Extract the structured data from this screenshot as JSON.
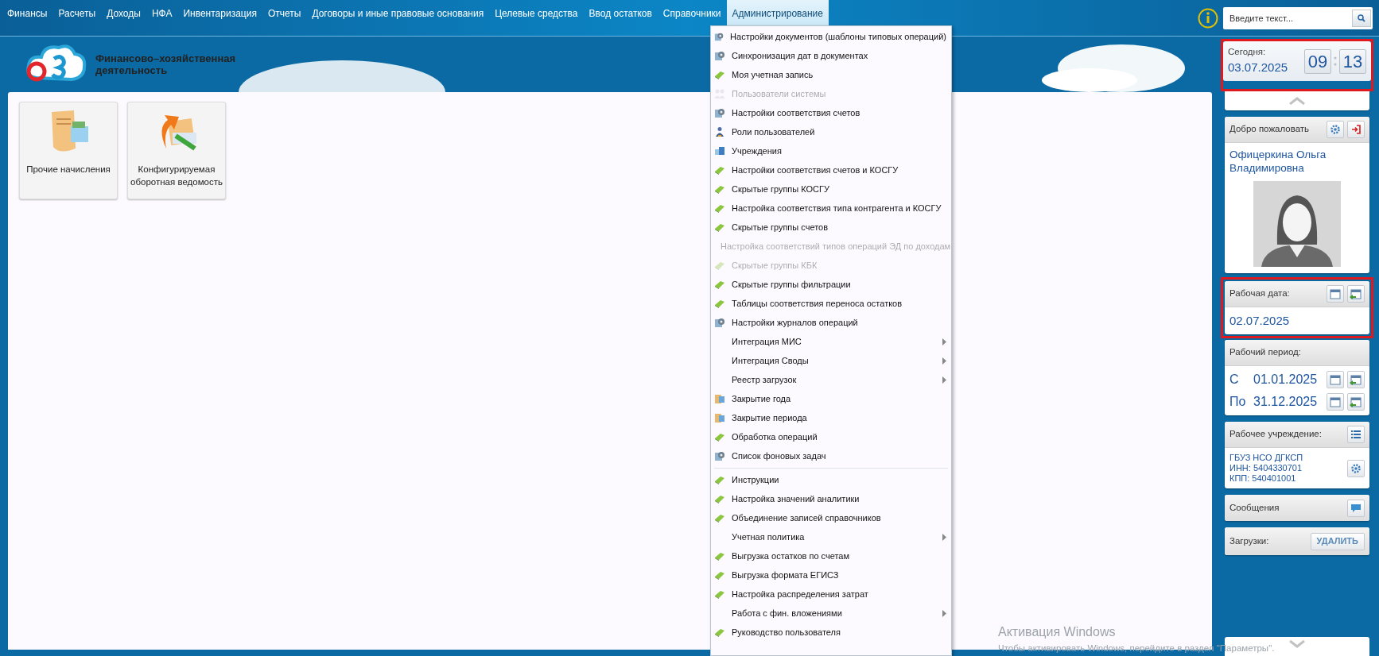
{
  "nav": [
    {
      "label": "Финансы",
      "selected": false
    },
    {
      "label": "Расчеты",
      "selected": false
    },
    {
      "label": "Доходы",
      "selected": false
    },
    {
      "label": "НФА",
      "selected": false
    },
    {
      "label": "Инвентаризация",
      "selected": false
    },
    {
      "label": "Отчеты",
      "selected": false
    },
    {
      "label": "Договоры и иные правовые основания",
      "selected": false
    },
    {
      "label": "Целевые средства",
      "selected": false
    },
    {
      "label": "Ввод остатков",
      "selected": false
    },
    {
      "label": "Справочники",
      "selected": false
    },
    {
      "label": "Администрирование",
      "selected": true
    }
  ],
  "search": {
    "placeholder": "Введите текст..."
  },
  "app_title": "Финансово–хозяйственная деятельность",
  "tiles": [
    {
      "label": "Прочие начисления",
      "kind": "document"
    },
    {
      "label": "Конфигурируемая оборотная ведомость",
      "kind": "ledger"
    }
  ],
  "menu": [
    {
      "kind": "gear",
      "label": "Настройки документов (шаблоны типовых операций)",
      "disabled": false,
      "submenu": false
    },
    {
      "kind": "gear",
      "label": "Синхронизация дат в документах",
      "disabled": false,
      "submenu": false
    },
    {
      "kind": "book",
      "label": "Моя учетная запись",
      "disabled": false,
      "submenu": false
    },
    {
      "kind": "users",
      "label": "Пользователи системы",
      "disabled": true,
      "submenu": false
    },
    {
      "kind": "gear",
      "label": "Настройки соответствия счетов",
      "disabled": false,
      "submenu": false
    },
    {
      "kind": "person",
      "label": "Роли пользователей",
      "disabled": false,
      "submenu": false
    },
    {
      "kind": "building",
      "label": "Учреждения",
      "disabled": false,
      "submenu": false
    },
    {
      "kind": "book",
      "label": "Настройки соответствия счетов и КОСГУ",
      "disabled": false,
      "submenu": false
    },
    {
      "kind": "book",
      "label": "Скрытые группы КОСГУ",
      "disabled": false,
      "submenu": false
    },
    {
      "kind": "book",
      "label": "Настройка соответствия типа контрагента и КОСГУ",
      "disabled": false,
      "submenu": false
    },
    {
      "kind": "book",
      "label": "Скрытые группы счетов",
      "disabled": false,
      "submenu": false
    },
    {
      "kind": "book",
      "label": "Настройка соответствий типов операций ЭД по доходам",
      "disabled": true,
      "submenu": false
    },
    {
      "kind": "book",
      "label": "Скрытые группы КБК",
      "disabled": true,
      "submenu": false
    },
    {
      "kind": "book",
      "label": "Скрытые группы фильтрации",
      "disabled": false,
      "submenu": false
    },
    {
      "kind": "book",
      "label": "Таблицы соответствия переноса остатков",
      "disabled": false,
      "submenu": false
    },
    {
      "kind": "gear",
      "label": "Настройки журналов операций",
      "disabled": false,
      "submenu": false
    },
    {
      "kind": "plain",
      "label": "Интеграция МИС",
      "disabled": false,
      "submenu": true
    },
    {
      "kind": "plain",
      "label": "Интеграция Своды",
      "disabled": false,
      "submenu": true
    },
    {
      "kind": "plain",
      "label": "Реестр загрузок",
      "disabled": false,
      "submenu": true
    },
    {
      "kind": "folder",
      "label": "Закрытие года",
      "disabled": false,
      "submenu": false
    },
    {
      "kind": "folder",
      "label": "Закрытие периода",
      "disabled": false,
      "submenu": false
    },
    {
      "kind": "book",
      "label": "Обработка операций",
      "disabled": false,
      "submenu": false
    },
    {
      "kind": "gear",
      "label": "Список фоновых задач",
      "disabled": false,
      "submenu": false
    },
    {
      "kind": "separator"
    },
    {
      "kind": "book",
      "label": "Инструкции",
      "disabled": false,
      "submenu": false
    },
    {
      "kind": "book",
      "label": "Настройка значений аналитики",
      "disabled": false,
      "submenu": false
    },
    {
      "kind": "book",
      "label": "Объединение записей справочников",
      "disabled": false,
      "submenu": false
    },
    {
      "kind": "plain",
      "label": "Учетная политика",
      "disabled": false,
      "submenu": true
    },
    {
      "kind": "book",
      "label": "Выгрузка остатков по счетам",
      "disabled": false,
      "submenu": false
    },
    {
      "kind": "book",
      "label": "Выгрузка формата ЕГИСЗ",
      "disabled": false,
      "submenu": false
    },
    {
      "kind": "book",
      "label": "Настройка распределения затрат",
      "disabled": false,
      "submenu": false
    },
    {
      "kind": "plain",
      "label": "Работа с фин. вложениями",
      "disabled": false,
      "submenu": true
    },
    {
      "kind": "book",
      "label": "Руководство пользователя",
      "disabled": false,
      "submenu": false
    }
  ],
  "today": {
    "label": "Сегодня:",
    "date": "03.07.2025",
    "hours": "09",
    "minutes": "13",
    "highlighted": true
  },
  "welcome": {
    "title": "Добро пожаловать",
    "user_name": "Офицеркина Ольга Владимировна"
  },
  "work_date": {
    "label": "Рабочая дата:",
    "date": "02.07.2025",
    "highlighted": true
  },
  "work_period": {
    "label": "Рабочий период:",
    "rows": [
      {
        "prefix": "С",
        "date": "01.01.2025"
      },
      {
        "prefix": "По",
        "date": "31.12.2025"
      }
    ]
  },
  "institution": {
    "label": "Рабочее учреждение:",
    "lines": [
      "ГБУЗ НСО ДГКСП",
      "ИНН: 5404330701",
      "КПП: 540401001"
    ]
  },
  "messages": {
    "label": "Сообщения"
  },
  "downloads": {
    "label": "Загрузки:",
    "button": "УДАЛИТЬ"
  },
  "os_notice": {
    "title": "Активация Windows",
    "text": "Чтобы активировать Windows, перейдите в раздел \"Параметры\"."
  }
}
